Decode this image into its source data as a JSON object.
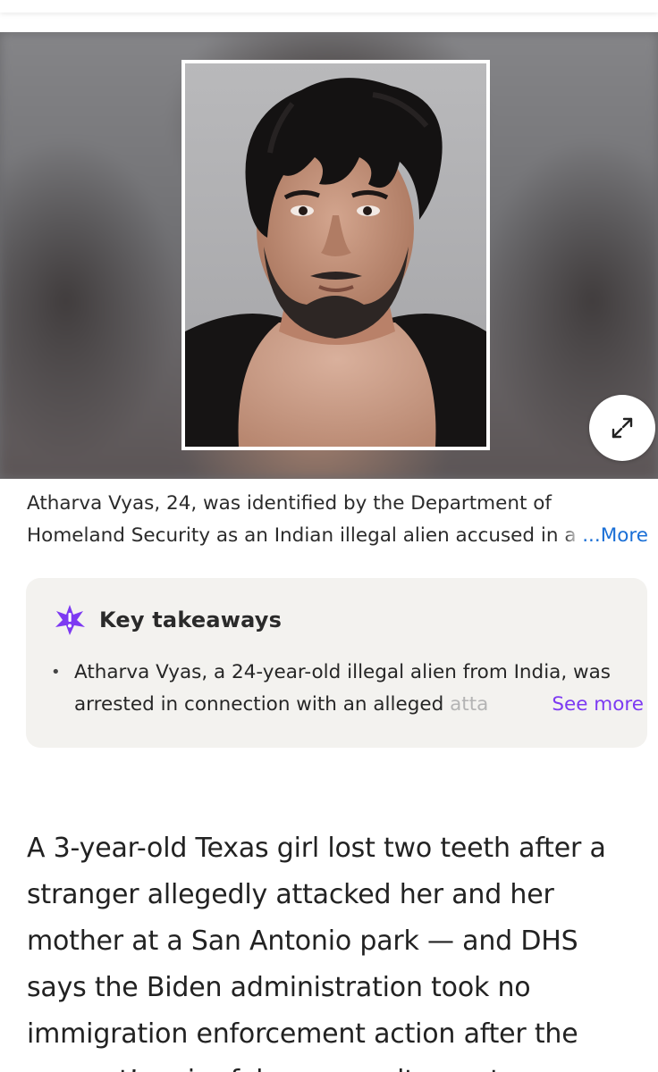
{
  "hero": {
    "expand_icon": "expand-arrows-icon"
  },
  "caption": {
    "line1": "Atharva Vyas, 24, was identified by the Department of",
    "line2": "Homeland Security as an Indian illegal alien accused in a",
    "more_label": "...More"
  },
  "takeaways": {
    "icon": "sparkle-icon",
    "title": "Key takeaways",
    "items": [
      {
        "line1": "Atharva Vyas, a 24-year-old illegal alien from India, was",
        "line2": "arrested in connection with an alleged ",
        "line2_fade": "atta"
      }
    ],
    "see_more_label": "See more",
    "accent_color": "#7d3af2"
  },
  "article": {
    "paragraph": "A 3-year-old Texas girl lost two teeth after a stranger allegedly attacked her and her mother at a San Antonio park — and DHS says the Biden administration took no immigration enforcement action after the suspect’s prior felony assault arrest."
  },
  "colors": {
    "link": "#1a6fd6",
    "card_bg": "#f3f2ef"
  }
}
